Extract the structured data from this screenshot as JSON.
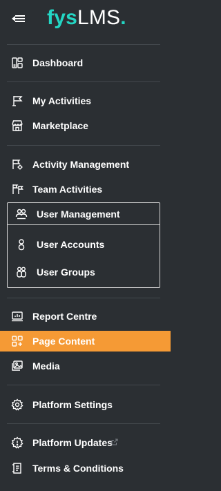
{
  "brand": {
    "logo_fys": "fys",
    "logo_lms": "LMS",
    "logo_dot": "."
  },
  "menu": {
    "dashboard": "Dashboard",
    "my_activities": "My Activities",
    "marketplace": "Marketplace",
    "activity_management": "Activity Management",
    "team_activities": "Team Activities",
    "user_management": "User Management",
    "user_accounts": "User Accounts",
    "user_groups": "User Groups",
    "report_centre": "Report Centre",
    "page_content": "Page Content",
    "media": "Media",
    "platform_settings": "Platform Settings",
    "platform_updates": "Platform Updates",
    "terms_conditions": "Terms & Conditions"
  },
  "colors": {
    "background": "#2b2f33",
    "active": "#f59a35",
    "brand_teal": "#23d6c4",
    "group_border": "#d8d8d8"
  },
  "icons": {
    "collapse": "collapse-arrow-icon",
    "dashboard": "dashboard-icon",
    "my_activities": "flag-icon",
    "marketplace": "store-icon",
    "activity_management": "flag-settings-icon",
    "team_activities": "flags-icon",
    "user_management": "users-settings-icon",
    "user_accounts": "user-icon",
    "user_groups": "user-groups-icon",
    "report_centre": "report-icon",
    "page_content": "page-content-icon",
    "media": "media-icon",
    "platform_settings": "gear-icon",
    "platform_updates": "gear-update-icon",
    "terms_conditions": "document-icon"
  }
}
